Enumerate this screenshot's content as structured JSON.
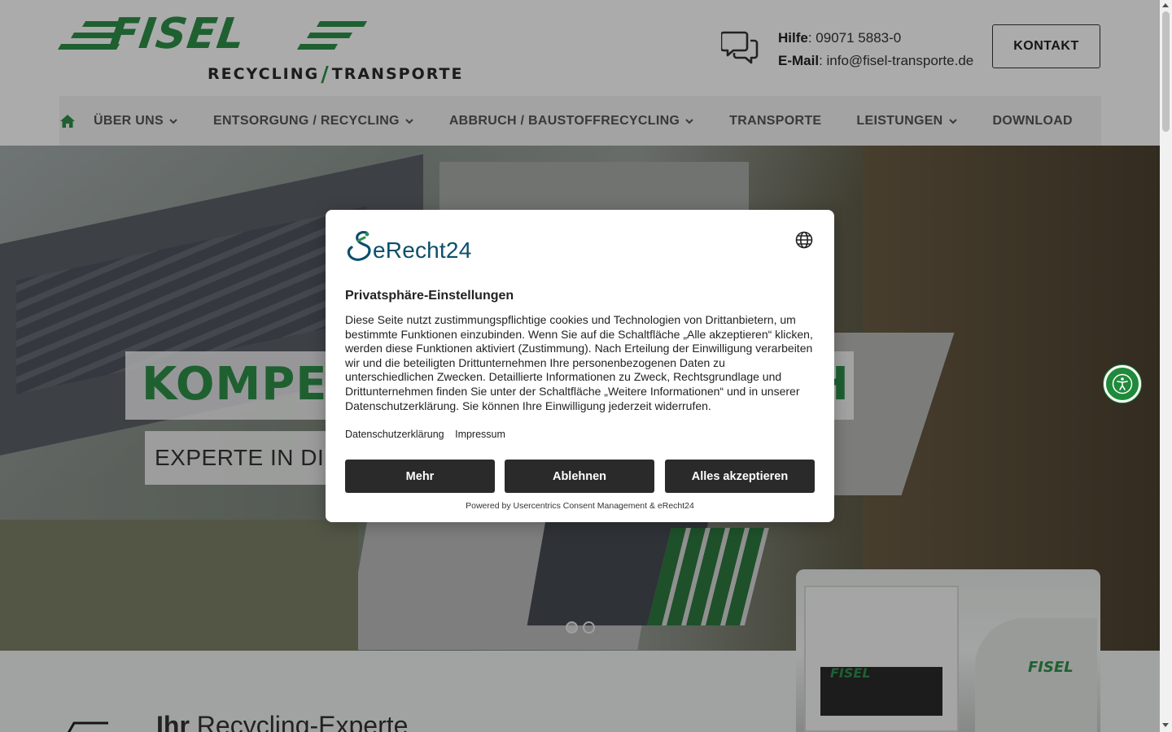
{
  "header": {
    "logo_name": "FISEL",
    "logo_sub_left": "RECYCLING",
    "logo_sub_right": "TRANSPORTE",
    "help_label": "Hilfe",
    "help_value": ": 09071 5883-0",
    "email_label": "E-Mail",
    "email_value": ": info@fisel-transporte.de",
    "contact_button": "KONTAKT"
  },
  "nav": {
    "items": [
      {
        "label": "ÜBER UNS",
        "dropdown": true
      },
      {
        "label": "ENTSORGUNG / RECYCLING",
        "dropdown": true
      },
      {
        "label": "ABBRUCH / BAUSTOFFRECYCLING",
        "dropdown": true
      },
      {
        "label": "TRANSPORTE",
        "dropdown": false
      },
      {
        "label": "LEISTUNGEN",
        "dropdown": true
      },
      {
        "label": "DOWNLOAD",
        "dropdown": false
      }
    ]
  },
  "hero": {
    "title": "KOMPET",
    "title_tail": "H",
    "subtitle": "EXPERTE IN DILLIN",
    "slide_count": 2,
    "active_slide": 1
  },
  "section": {
    "title_bold": "Ihr",
    "title_rest": " Recycling-Experte"
  },
  "consent": {
    "brand": "eRecht24",
    "title": "Privatsphäre-Einstellungen",
    "body": "Diese Seite nutzt zustimmungspflichtige cookies und Technologien von Drittanbietern, um bestimmte Funktionen einzubinden. Wenn Sie auf die Schaltfläche „Alle akzeptieren“ klicken, werden diese Funktionen aktiviert (Zustimmung). Nach Erteilung der Einwilligung verarbeiten wir und die beteiligten Drittunternehmen Ihre personenbezogenen Daten zu unterschiedlichen Zwecken. Detaillierte Informationen zu Zweck, Rechtsgrundlage und Drittunternehmen finden Sie unter der Schaltfläche „Weitere Informationen“ und in unserer Datenschutzerklärung. Sie können Ihre Einwilligung jederzeit widerrufen.",
    "link_privacy": "Datenschutzerklärung",
    "link_imprint": "Impressum",
    "btn_more": "Mehr",
    "btn_decline": "Ablehnen",
    "btn_accept": "Alles akzeptieren",
    "powered_by": "Powered by Usercentrics Consent Management & eRecht24"
  },
  "colors": {
    "brand_green": "#2f8f4a",
    "dark_button": "#2a2a2a",
    "accessibility_green": "#1f8a3a"
  },
  "icons": [
    "home-icon",
    "chat-icon",
    "chevron-down-icon",
    "globe-icon",
    "accessibility-icon"
  ]
}
